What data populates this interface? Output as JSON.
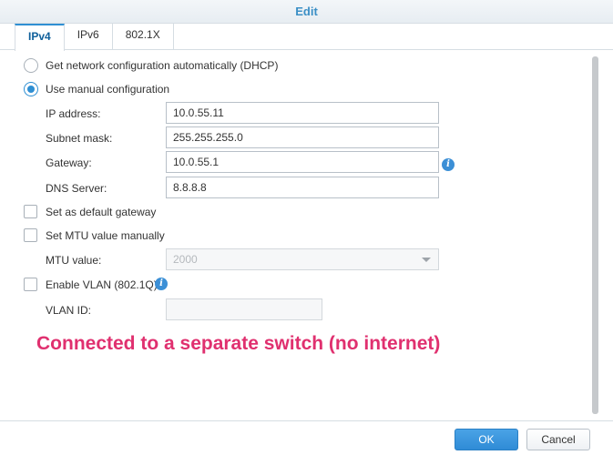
{
  "window": {
    "title": "Edit"
  },
  "tabs": [
    {
      "label": "IPv4",
      "active": true
    },
    {
      "label": "IPv6",
      "active": false
    },
    {
      "label": "802.1X",
      "active": false
    }
  ],
  "ipv4": {
    "dhcp_label": "Get network configuration automatically (DHCP)",
    "dhcp_selected": false,
    "manual_label": "Use manual configuration",
    "manual_selected": true,
    "ip_address": {
      "label": "IP address:",
      "value": "10.0.55.11"
    },
    "subnet_mask": {
      "label": "Subnet mask:",
      "value": "255.255.255.0"
    },
    "gateway": {
      "label": "Gateway:",
      "value": "10.0.55.1"
    },
    "dns_server": {
      "label": "DNS Server:",
      "value": "8.8.8.8"
    },
    "default_gateway_label": "Set as default gateway",
    "default_gateway_checked": false,
    "mtu_manual_label": "Set MTU value manually",
    "mtu_manual_checked": false,
    "mtu": {
      "label": "MTU value:",
      "value": "2000"
    },
    "vlan_label": "Enable VLAN (802.1Q)",
    "vlan_checked": false,
    "vlan_id": {
      "label": "VLAN ID:",
      "value": ""
    }
  },
  "annotation": "Connected to a separate switch (no internet)",
  "buttons": {
    "ok": "OK",
    "cancel": "Cancel"
  },
  "colors": {
    "accent": "#2f8fd3",
    "annotation": "#e0306f",
    "title": "#3b8fc6"
  },
  "icons": {
    "info": "info-icon"
  }
}
